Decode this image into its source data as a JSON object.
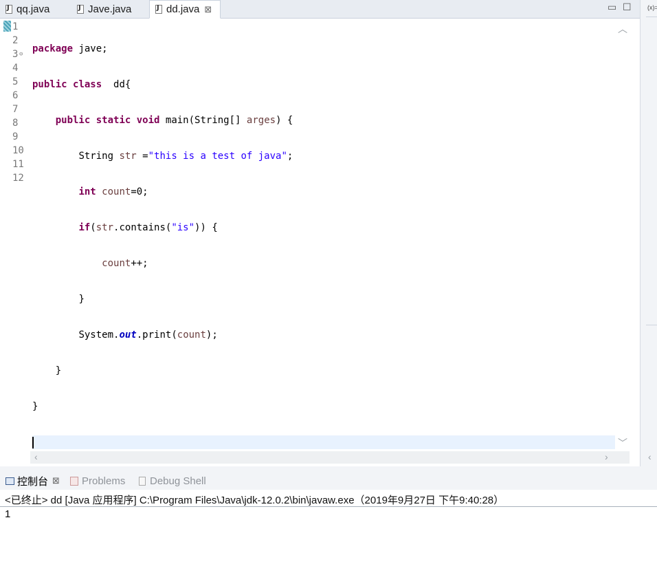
{
  "editor": {
    "tabs": [
      {
        "label": "qq.java",
        "active": false
      },
      {
        "label": "Jave.java",
        "active": false
      },
      {
        "label": "dd.java",
        "active": true,
        "close": "⊠"
      }
    ],
    "window_controls": {
      "minimize": "▭",
      "maximize": "☐"
    },
    "line_numbers": [
      "1",
      "2",
      "3",
      "4",
      "5",
      "6",
      "7",
      "8",
      "9",
      "10",
      "11",
      "12"
    ],
    "code": {
      "l1_kw": "package",
      "l1_rest": " jave;",
      "l2_kw1": "public",
      "l2_kw2": "class",
      "l2_rest": "  dd{",
      "l3_kw1": "public",
      "l3_kw2": "static",
      "l3_kw3": "void",
      "l3_rest": " main(String[] ",
      "l3_param": "arges",
      "l3_end": ") {",
      "l4_type": "String ",
      "l4_var": "str",
      "l4_eq": " =",
      "l4_str": "\"this is a test of java\"",
      "l4_end": ";",
      "l5_kw": "int",
      "l5_var": "count",
      "l5_end": "=0;",
      "l6_kw": "if",
      "l6_open": "(",
      "l6_var": "str",
      "l6_mid": ".contains(",
      "l6_str": "\"is\"",
      "l6_end": ")) {",
      "l7_var": "count",
      "l7_end": "++;",
      "l8": "}",
      "l9_a": "System.",
      "l9_field": "out",
      "l9_b": ".print(",
      "l9_var": "count",
      "l9_end": ");",
      "l10": "}",
      "l11": "}"
    }
  },
  "side_panel": {
    "label": "(x)="
  },
  "console": {
    "tabs": [
      {
        "label": "控制台",
        "close": "⊠"
      },
      {
        "label": "Problems"
      },
      {
        "label": "Debug Shell"
      }
    ],
    "header": "<已终止> dd [Java 应用程序] C:\\Program Files\\Java\\jdk-12.0.2\\bin\\javaw.exe（2019年9月27日 下午9:40:28）",
    "output": "1"
  }
}
